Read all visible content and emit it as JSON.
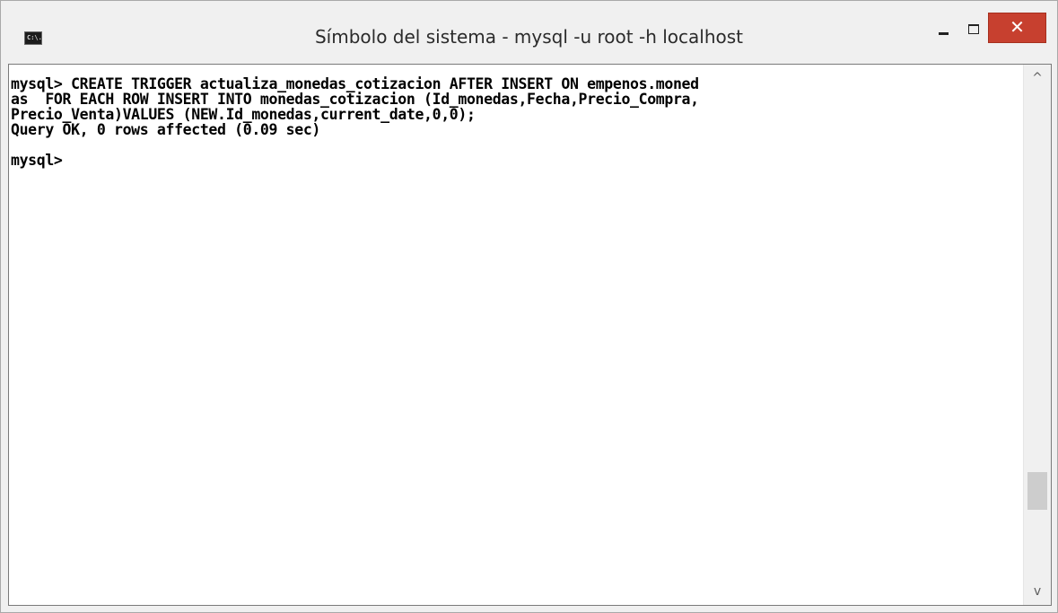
{
  "window": {
    "title": "Símbolo del sistema - mysql  -u root  -h localhost",
    "icon": "cmd-icon",
    "icon_text": "C:\\.",
    "controls": {
      "minimize": "minimize-icon",
      "maximize": "maximize-icon",
      "close_label": "✕",
      "close_color": "#c7402f"
    }
  },
  "console": {
    "lines": [
      "mysql> CREATE TRIGGER actualiza_monedas_cotizacion AFTER INSERT ON empenos.moned",
      "as  FOR EACH ROW INSERT INTO monedas_cotizacion (Id_monedas,Fecha,Precio_Compra,",
      "Precio_Venta)VALUES (NEW.Id_monedas,current_date,0,0);",
      "Query OK, 0 rows affected (0.09 sec)",
      "",
      "mysql>"
    ]
  },
  "scrollbar": {
    "up_icon": "^",
    "down_icon": "v"
  }
}
